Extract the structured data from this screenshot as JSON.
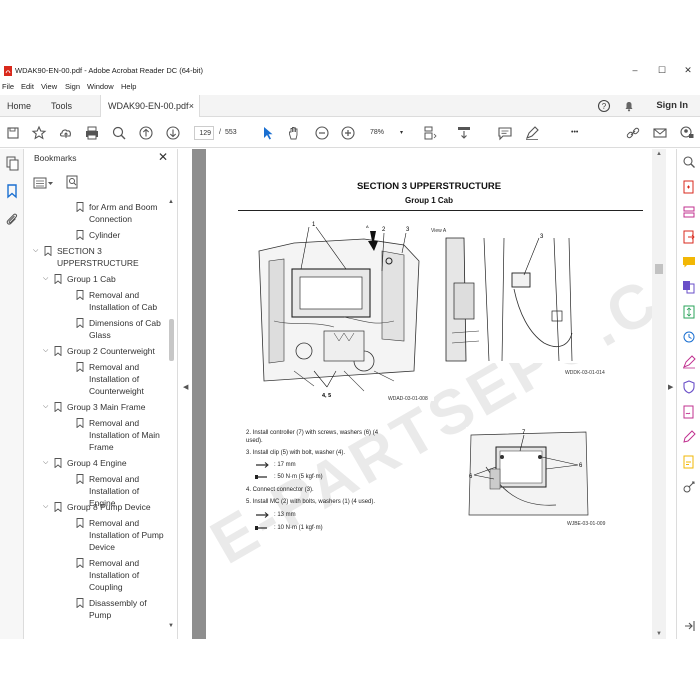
{
  "window": {
    "title": "WDAK90-EN-00.pdf - Adobe Acrobat Reader DC (64-bit)",
    "minimize": "–",
    "maximize": "☐",
    "close": "✕"
  },
  "menu": [
    "File",
    "Edit",
    "View",
    "Sign",
    "Window",
    "Help"
  ],
  "tabs": {
    "home": "Home",
    "tools": "Tools",
    "document": "WDAK90-EN-00.pdf",
    "close": "×",
    "sign_in": "Sign In"
  },
  "toolbar": {
    "current_page": "129",
    "page_separator": "/",
    "total_pages": "553",
    "zoom": "78%",
    "zoom_caret": "▾",
    "more": "•••"
  },
  "bookmarks": {
    "title": "Bookmarks",
    "close": "✕",
    "items": [
      {
        "label": "for Arm and Boom\nConnection",
        "indent": 2,
        "chevron": ""
      },
      {
        "label": "Cylinder",
        "indent": 2,
        "chevron": ""
      },
      {
        "label": "SECTION 3\nUPPERSTRUCTURE",
        "indent": 0,
        "chevron": "v"
      },
      {
        "label": "Group 1 Cab",
        "indent": 1,
        "chevron": "v"
      },
      {
        "label": "Removal and\nInstallation of Cab",
        "indent": 2,
        "chevron": ""
      },
      {
        "label": "Dimensions of Cab\nGlass",
        "indent": 2,
        "chevron": ""
      },
      {
        "label": "Group 2 Counterweight",
        "indent": 1,
        "chevron": "v"
      },
      {
        "label": "Removal and\nInstallation of\nCounterweight",
        "indent": 2,
        "chevron": ""
      },
      {
        "label": "Group 3 Main Frame",
        "indent": 1,
        "chevron": "v"
      },
      {
        "label": "Removal and\nInstallation of Main\nFrame",
        "indent": 2,
        "chevron": ""
      },
      {
        "label": "Group 4 Engine",
        "indent": 1,
        "chevron": "v"
      },
      {
        "label": "Removal and\nInstallation of Engine",
        "indent": 2,
        "chevron": ""
      },
      {
        "label": "Group 8 Pump Device",
        "indent": 1,
        "chevron": "v"
      },
      {
        "label": "Removal and\nInstallation of Pump\nDevice",
        "indent": 2,
        "chevron": ""
      },
      {
        "label": "Removal and\nInstallation of\nCoupling",
        "indent": 2,
        "chevron": ""
      },
      {
        "label": "Disassembly of Pump",
        "indent": 2,
        "chevron": ""
      }
    ]
  },
  "document": {
    "section_title": "SECTION 3 UPPERSTRUCTURE",
    "group_title": "Group 1 Cab",
    "view_label": "View A",
    "fig1": {
      "id": "WDAD-03-01-008",
      "labels": [
        "1",
        "A",
        "2",
        "3",
        "4, 5"
      ]
    },
    "fig2": {
      "id": "WDDK-03-01-014",
      "labels": [
        "3"
      ]
    },
    "fig3": {
      "id": "WJBE-03-01-009",
      "labels": [
        "7",
        "6",
        "6"
      ]
    },
    "steps": [
      "2.  Install controller (7) with screws, washers (6) (4",
      "     used).",
      "3.  Install clip (5) with bolt, washer (4).",
      ": 17 mm",
      ": 50 N·m (5 kgf·m)",
      "4.  Connect connector (3).",
      "5.  Install MC (2) with bolts, washers (1) (4 used).",
      ": 13 mm",
      ": 10 N·m (1 kgf·m)"
    ],
    "watermark": "E-PARTSEPC.COM"
  },
  "colors": {
    "accent": "#1a6fd1",
    "page_bg": "#8e8e8e",
    "pdf_red": "#d9291c"
  }
}
